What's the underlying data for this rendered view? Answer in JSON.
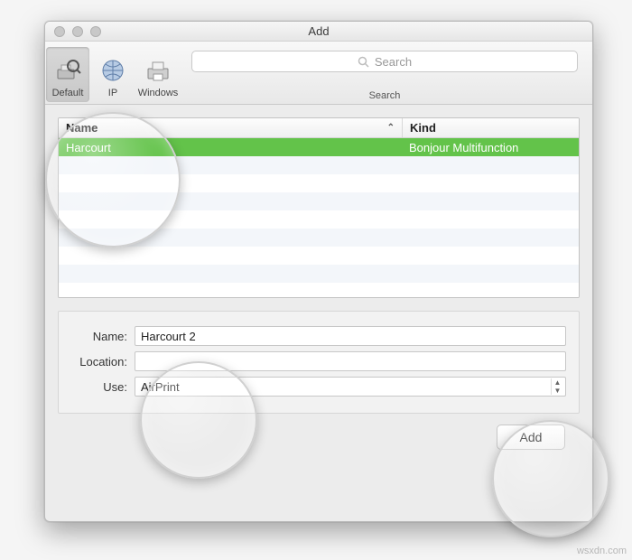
{
  "window": {
    "title": "Add"
  },
  "toolbar": {
    "items": [
      {
        "label": "Default"
      },
      {
        "label": "IP"
      },
      {
        "label": "Windows"
      }
    ],
    "search_placeholder": "Search",
    "search_label": "Search"
  },
  "list": {
    "columns": {
      "name": "Name",
      "kind": "Kind"
    },
    "rows": [
      {
        "name": "Harcourt",
        "kind": "Bonjour Multifunction",
        "selected": true
      }
    ]
  },
  "form": {
    "name_label": "Name:",
    "name_value": "Harcourt 2",
    "location_label": "Location:",
    "location_value": "",
    "use_label": "Use:",
    "use_value": "AirPrint"
  },
  "actions": {
    "add_label": "Add"
  },
  "watermark": "wsxdn.com"
}
